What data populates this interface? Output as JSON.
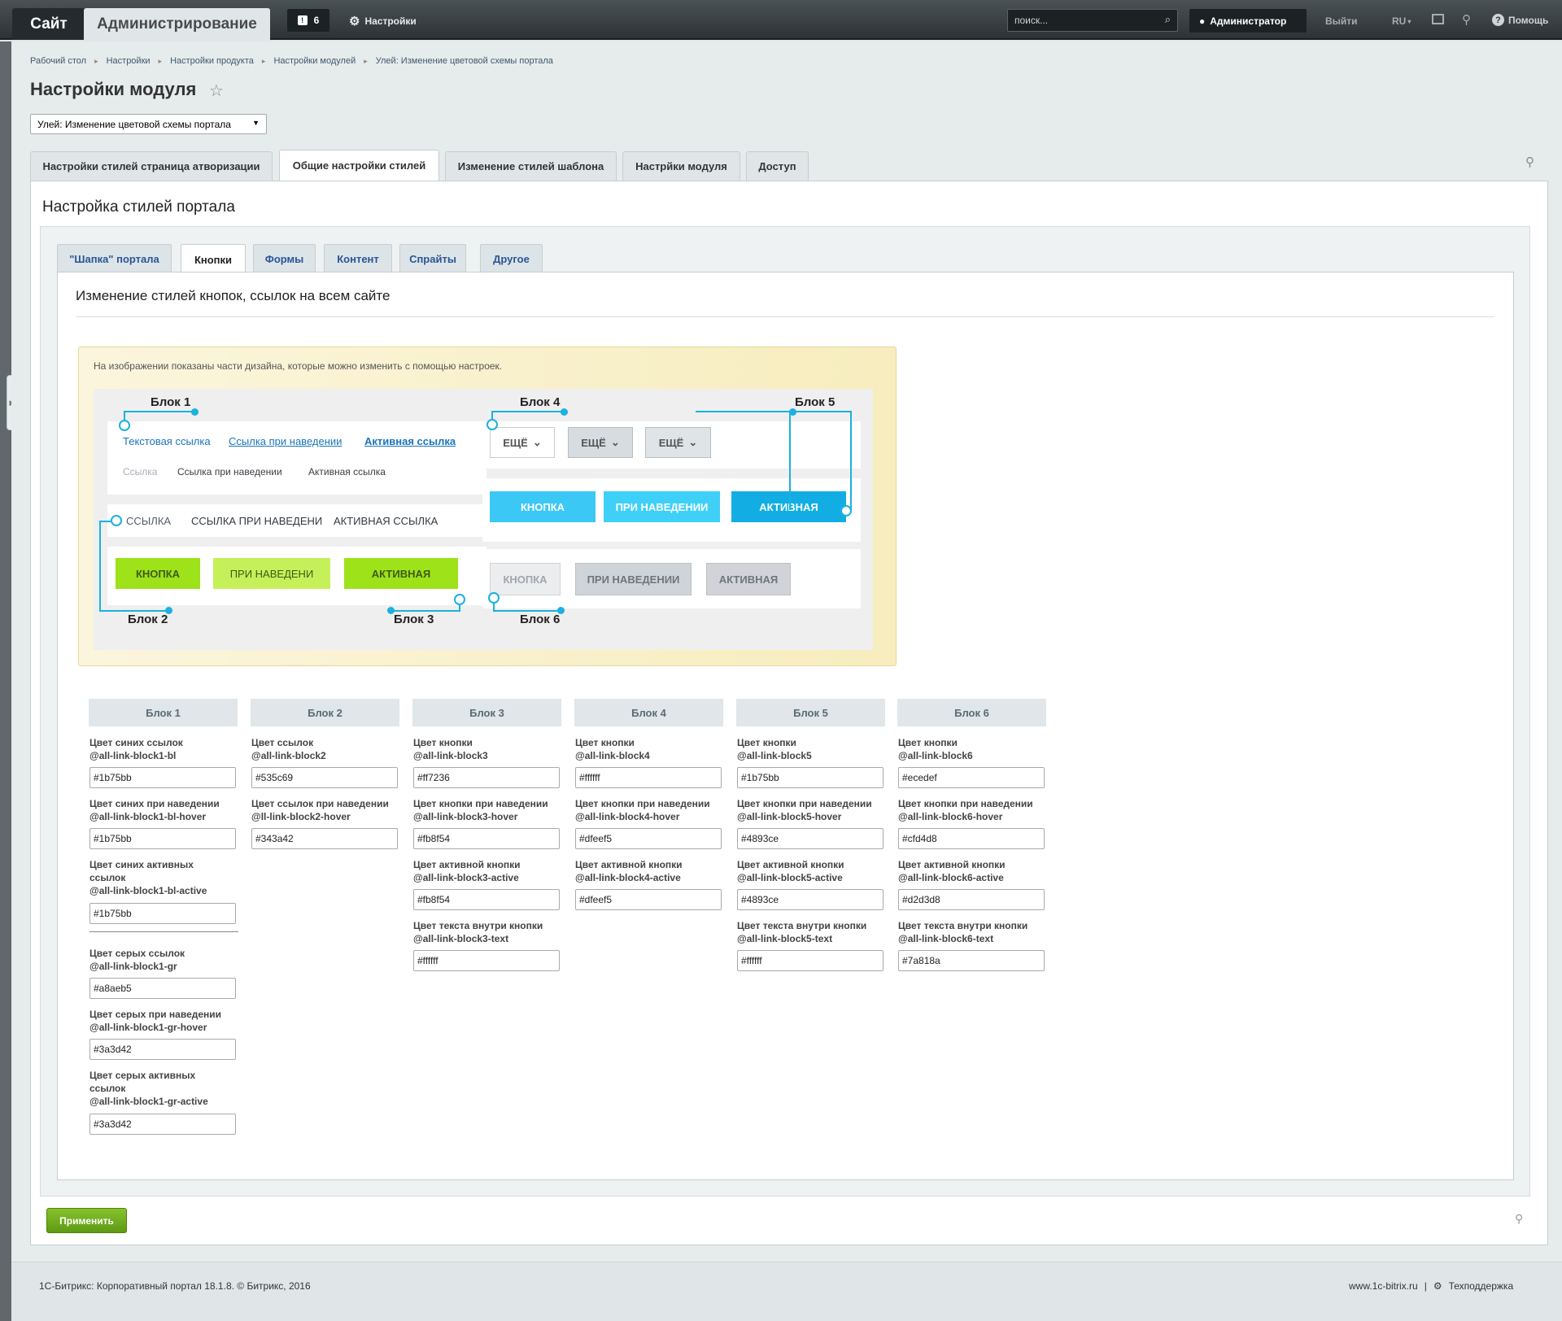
{
  "topbar": {
    "site": "Сайт",
    "admin": "Администрирование",
    "notif_count": "6",
    "settings": "Настройки",
    "search_placeholder": "поиск...",
    "user": "Администратор",
    "logout": "Выйти",
    "lang": "RU",
    "help": "Помощь"
  },
  "breadcrumbs": [
    "Рабочий стол",
    "Настройки",
    "Настройки продукта",
    "Настройки модулей",
    "Улей: Изменение цветовой схемы портала"
  ],
  "page_title": "Настройки модуля",
  "module_select": "Улей: Изменение цветовой схемы портала",
  "tabs": [
    "Настройки стилей страница атворизации",
    "Общие настройки стилей",
    "Изменение стилей шаблона",
    "Настрйки модуля",
    "Доступ"
  ],
  "panel_title": "Настройка стилей портала",
  "subtabs": [
    "\"Шапка\" портала",
    "Кнопки",
    "Формы",
    "Контент",
    "Спрайты",
    "Другое"
  ],
  "section_title": "Изменение стилей кнопок, ссылок на всем сайте",
  "info_text": "На изображении показаны части дизайна, которые можно изменить с помощью настроек.",
  "demo": {
    "block_labels": [
      "Блок 1",
      "Блок 2",
      "Блок 3",
      "Блок 4",
      "Блок 5",
      "Блок 6"
    ],
    "blue_links": [
      "Текстовая ссылка",
      "Ссылка при наведении",
      "Активная ссылка"
    ],
    "gray_links": [
      "Ссылка",
      "Ссылка при наведении",
      "Активная ссылка"
    ],
    "caps_links": [
      "ССЫЛКА",
      "ССЫЛКА ПРИ НАВЕДЕНИ",
      "АКТИВНАЯ ССЫЛКА"
    ],
    "green_buttons": [
      "КНОПКА",
      "ПРИ НАВЕДЕНИ",
      "АКТИВНАЯ"
    ],
    "more_buttons": [
      "ЕЩЁ",
      "ЕЩЁ",
      "ЕЩЁ"
    ],
    "blue_buttons": [
      "КНОПКА",
      "ПРИ НАВЕДЕНИИ",
      "АКТИВНАЯ"
    ],
    "gray_buttons": [
      "КНОПКА",
      "ПРИ НАВЕДЕНИИ",
      "АКТИВНАЯ"
    ]
  },
  "blocks": [
    {
      "title": "Блок 1",
      "fields": [
        {
          "l1": "Цвет синих ссылок",
          "l2": "@all-link-block1-bl",
          "v": "#1b75bb"
        },
        {
          "l1": "Цвет синих при наведении",
          "l2": "@all-link-block1-bl-hover",
          "v": "#1b75bb"
        },
        {
          "l1": "Цвет синих активных",
          "l1b": "ссылок",
          "l2": "@all-link-block1-bl-active",
          "v": "#1b75bb"
        },
        {
          "l1": "Цвет серых ссылок",
          "l2": "@all-link-block1-gr",
          "v": "#a8aeb5"
        },
        {
          "l1": "Цвет серых при наведении",
          "l2": "@all-link-block1-gr-hover",
          "v": "#3a3d42"
        },
        {
          "l1": "Цвет серых активных",
          "l1b": "ссылок",
          "l2": "@all-link-block1-gr-active",
          "v": "#3a3d42"
        }
      ]
    },
    {
      "title": "Блок 2",
      "fields": [
        {
          "l1": "Цвет ссылок",
          "l2": "@all-link-block2",
          "v": "#535c69"
        },
        {
          "l1": "Цвет ссылок при наведении",
          "l2": "@ll-link-block2-hover",
          "v": "#343a42"
        }
      ]
    },
    {
      "title": "Блок 3",
      "fields": [
        {
          "l1": "Цвет кнопки",
          "l2": "@all-link-block3",
          "v": "#ff7236"
        },
        {
          "l1": "Цвет кнопки при наведении",
          "l2": "@all-link-block3-hover",
          "v": "#fb8f54"
        },
        {
          "l1": "Цвет активной кнопки",
          "l2": "@all-link-block3-active",
          "v": "#fb8f54"
        },
        {
          "l1": "Цвет текста внутри кнопки",
          "l2": "@all-link-block3-text",
          "v": "#ffffff"
        }
      ]
    },
    {
      "title": "Блок 4",
      "fields": [
        {
          "l1": "Цвет кнопки",
          "l2": "@all-link-block4",
          "v": "#ffffff"
        },
        {
          "l1": "Цвет кнопки при наведении",
          "l2": "@all-link-block4-hover",
          "v": "#dfeef5"
        },
        {
          "l1": "Цвет активной кнопки",
          "l2": "@all-link-block4-active",
          "v": "#dfeef5"
        }
      ]
    },
    {
      "title": "Блок 5",
      "fields": [
        {
          "l1": "Цвет кнопки",
          "l2": "@all-link-block5",
          "v": "#1b75bb"
        },
        {
          "l1": "Цвет кнопки при наведении",
          "l2": "@all-link-block5-hover",
          "v": "#4893ce"
        },
        {
          "l1": "Цвет активной кнопки",
          "l2": "@all-link-block5-active",
          "v": "#4893ce"
        },
        {
          "l1": "Цвет текста внутри кнопки",
          "l2": "@all-link-block5-text",
          "v": "#ffffff"
        }
      ]
    },
    {
      "title": "Блок 6",
      "fields": [
        {
          "l1": "Цвет кнопки",
          "l2": "@all-link-block6",
          "v": "#ecedef"
        },
        {
          "l1": "Цвет кнопки при наведении",
          "l2": "@all-link-block6-hover",
          "v": "#cfd4d8"
        },
        {
          "l1": "Цвет активной кнопки",
          "l2": "@all-link-block6-active",
          "v": "#d2d3d8"
        },
        {
          "l1": "Цвет текста внутри кнопки",
          "l2": "@all-link-block6-text",
          "v": "#7a818a"
        }
      ]
    }
  ],
  "apply": "Применить",
  "footer": {
    "copyright": "1С-Битрикс: Корпоративный портал 18.1.8. © Битрикс, 2016",
    "site": "www.1c-bitrix.ru",
    "sep": "|",
    "support": "Техподдержка"
  }
}
